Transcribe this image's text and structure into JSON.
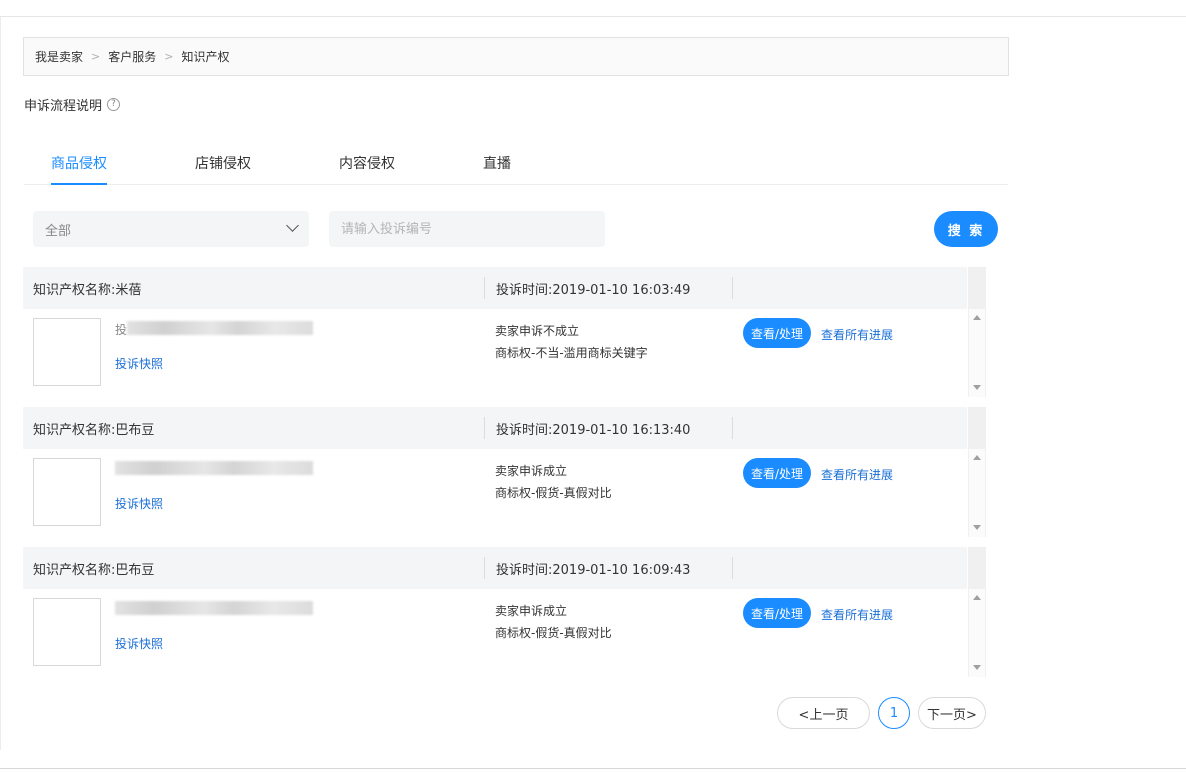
{
  "breadcrumb": {
    "items": [
      "我是卖家",
      "客户服务",
      "知识产权"
    ],
    "separator": ">"
  },
  "process": {
    "label": "申诉流程说明",
    "help_icon": "?"
  },
  "tabs": [
    {
      "label": "商品侵权",
      "active": true
    },
    {
      "label": "店铺侵权",
      "active": false
    },
    {
      "label": "内容侵权",
      "active": false
    },
    {
      "label": "直播",
      "active": false
    }
  ],
  "filter": {
    "status_value": "全部",
    "search_placeholder": "请输入投诉编号",
    "search_button": "搜 索"
  },
  "complaints": [
    {
      "name": "知识产权名称:米蓓",
      "time": "投诉时间:2019-01-10 16:03:49",
      "title_partial": "投",
      "snapshot_link": "投诉快照",
      "status": "卖家申诉不成立",
      "reason": "商标权-不当-滥用商标关键字",
      "action": "查看/处理",
      "progress_link": "查看所有进展"
    },
    {
      "name": "知识产权名称:巴布豆",
      "time": "投诉时间:2019-01-10 16:13:40",
      "title_partial": "",
      "snapshot_link": "投诉快照",
      "status": "卖家申诉成立",
      "reason": "商标权-假货-真假对比",
      "action": "查看/处理",
      "progress_link": "查看所有进展"
    },
    {
      "name": "知识产权名称:巴布豆",
      "time": "投诉时间:2019-01-10 16:09:43",
      "title_partial": "",
      "snapshot_link": "投诉快照",
      "status": "卖家申诉成立",
      "reason": "商标权-假货-真假对比",
      "action": "查看/处理",
      "progress_link": "查看所有进展"
    }
  ],
  "pagination": {
    "prev": "<上一页",
    "current": "1",
    "next": "下一页>"
  },
  "colors": {
    "accent": "#1a8cff",
    "link": "#1a6fd6",
    "panel_bg": "#f4f5f7"
  }
}
